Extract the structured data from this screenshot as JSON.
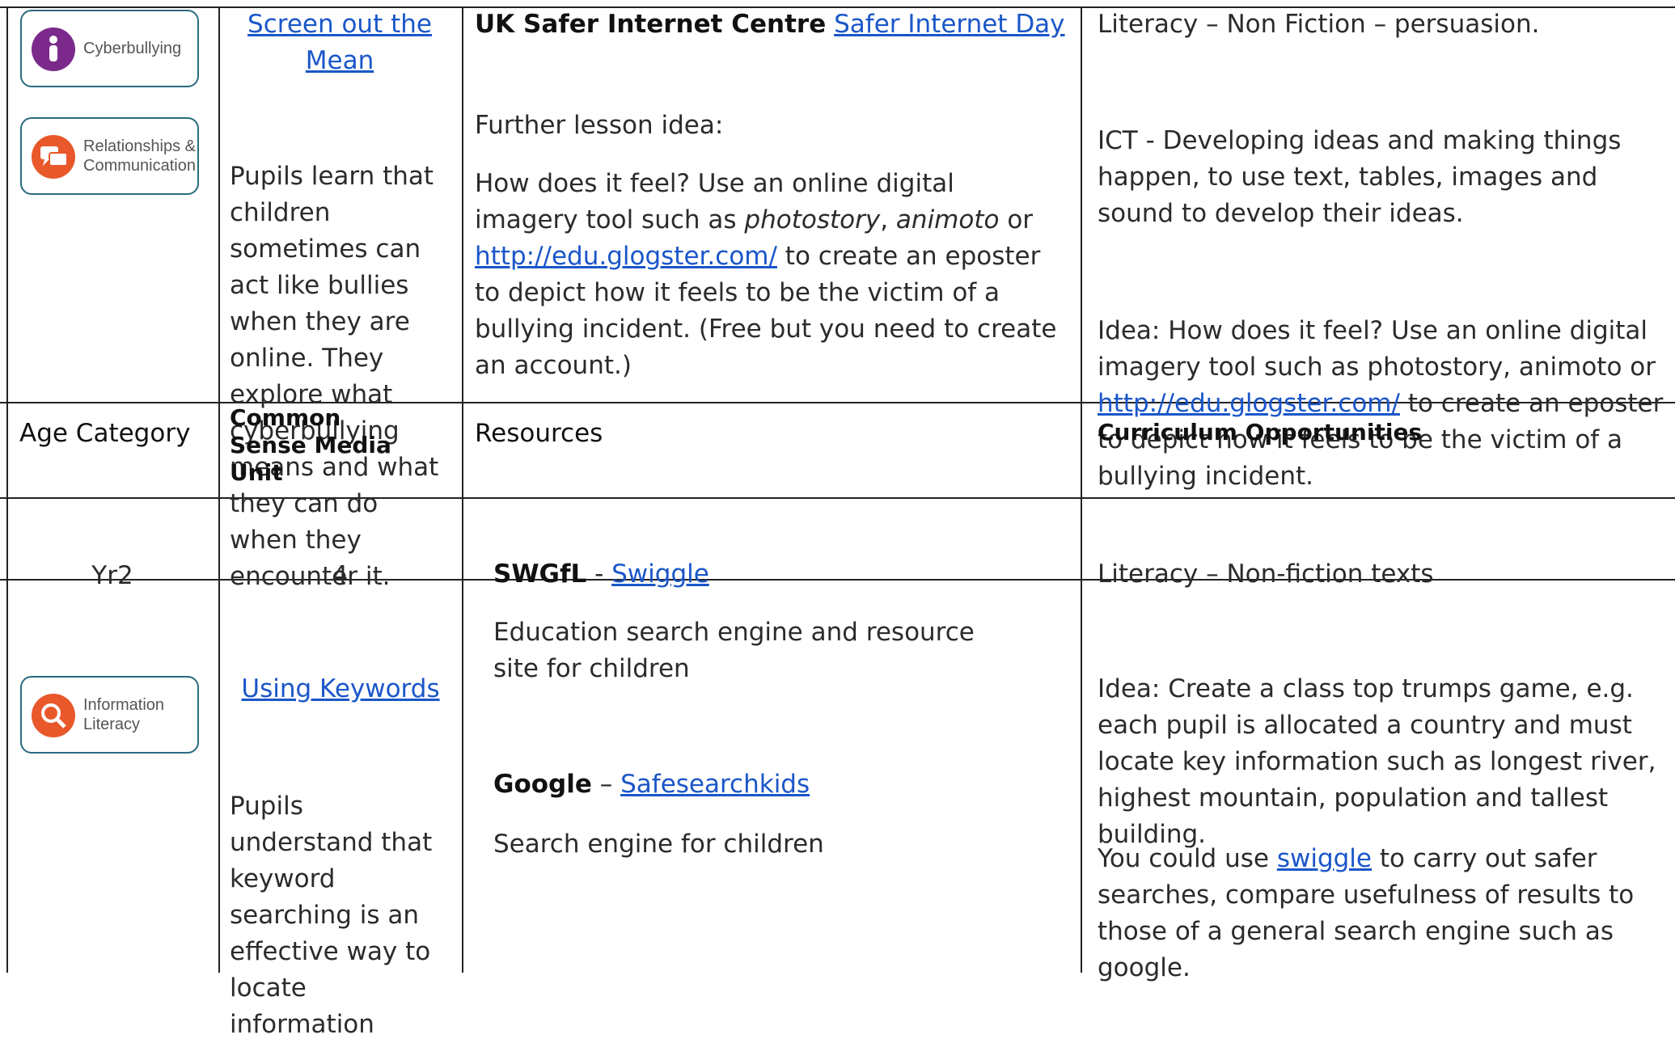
{
  "header_row": {
    "age_category": "Age Category",
    "media_unit": "Common Sense Media Unit",
    "resources": "Resources",
    "curriculum": "Curriculum Opportunities"
  },
  "row1": {
    "badges": [
      "Cyberbullying",
      "Relationships & Communication"
    ],
    "unit_link": "Screen out the Mean",
    "unit_desc": "Pupils learn that children sometimes can act like bullies when they are online. They explore what cyberbullying means and what they can do when they encounter it.",
    "resource_org": "UK Safer Internet Centre",
    "resource_link": "Safer Internet Day",
    "further_title": "Further lesson idea:",
    "further_text_1": "How does it feel? Use an online digital imagery tool such as",
    "photostory": "photostory",
    "animoto": "animoto",
    "or": "or",
    "glogster_link": "http://edu.glogster.com/",
    "further_text_2": "to create an eposter to depict how it feels to be the victim of a bullying incident. (Free but you need to create an account.)",
    "curr_1": "Literacy – Non Fiction – persuasion.",
    "curr_2": "ICT - Developing ideas and making things happen, to use text, tables, images and sound to develop their ideas.",
    "curr_idea_1": "Idea: How does it feel? Use an online digital imagery tool such as photostory, animoto or",
    "curr_glogster": "http://edu.glogster.com/",
    "curr_idea_2": "to create an eposter to depict how it feels to be the victim of a bullying incident."
  },
  "row2": {
    "age": "Yr2",
    "unit_no": "4",
    "swgfl": "SWGfL",
    "dash1": "-",
    "swiggle_link": "Swiggle",
    "curr_1": "Literacy – Non-fiction texts"
  },
  "row3": {
    "badge": "Information Literacy",
    "unit_link": "Using Keywords",
    "unit_desc": "Pupils understand that keyword searching is an effective way to locate information",
    "swiggle_desc": "Education search engine and resource site for children",
    "google": "Google",
    "dash2": "–",
    "safesearch_link": "Safesearchkids",
    "google_desc": "Search engine for children",
    "curr_idea": "Idea: Create a class top trumps game, e.g. each pupil is allocated a country and must locate key information such as longest river, highest mountain, population and tallest building.",
    "curr_use_1": "You could use",
    "curr_swiggle": "swiggle",
    "curr_use_2": "to carry out safer searches, compare usefulness of results to those of a general search engine such as google."
  },
  "colors": {
    "link": "#1a56c9",
    "badge_border": "#2a6b80",
    "purple": "#7b2a8c",
    "orange": "#e8582a"
  }
}
